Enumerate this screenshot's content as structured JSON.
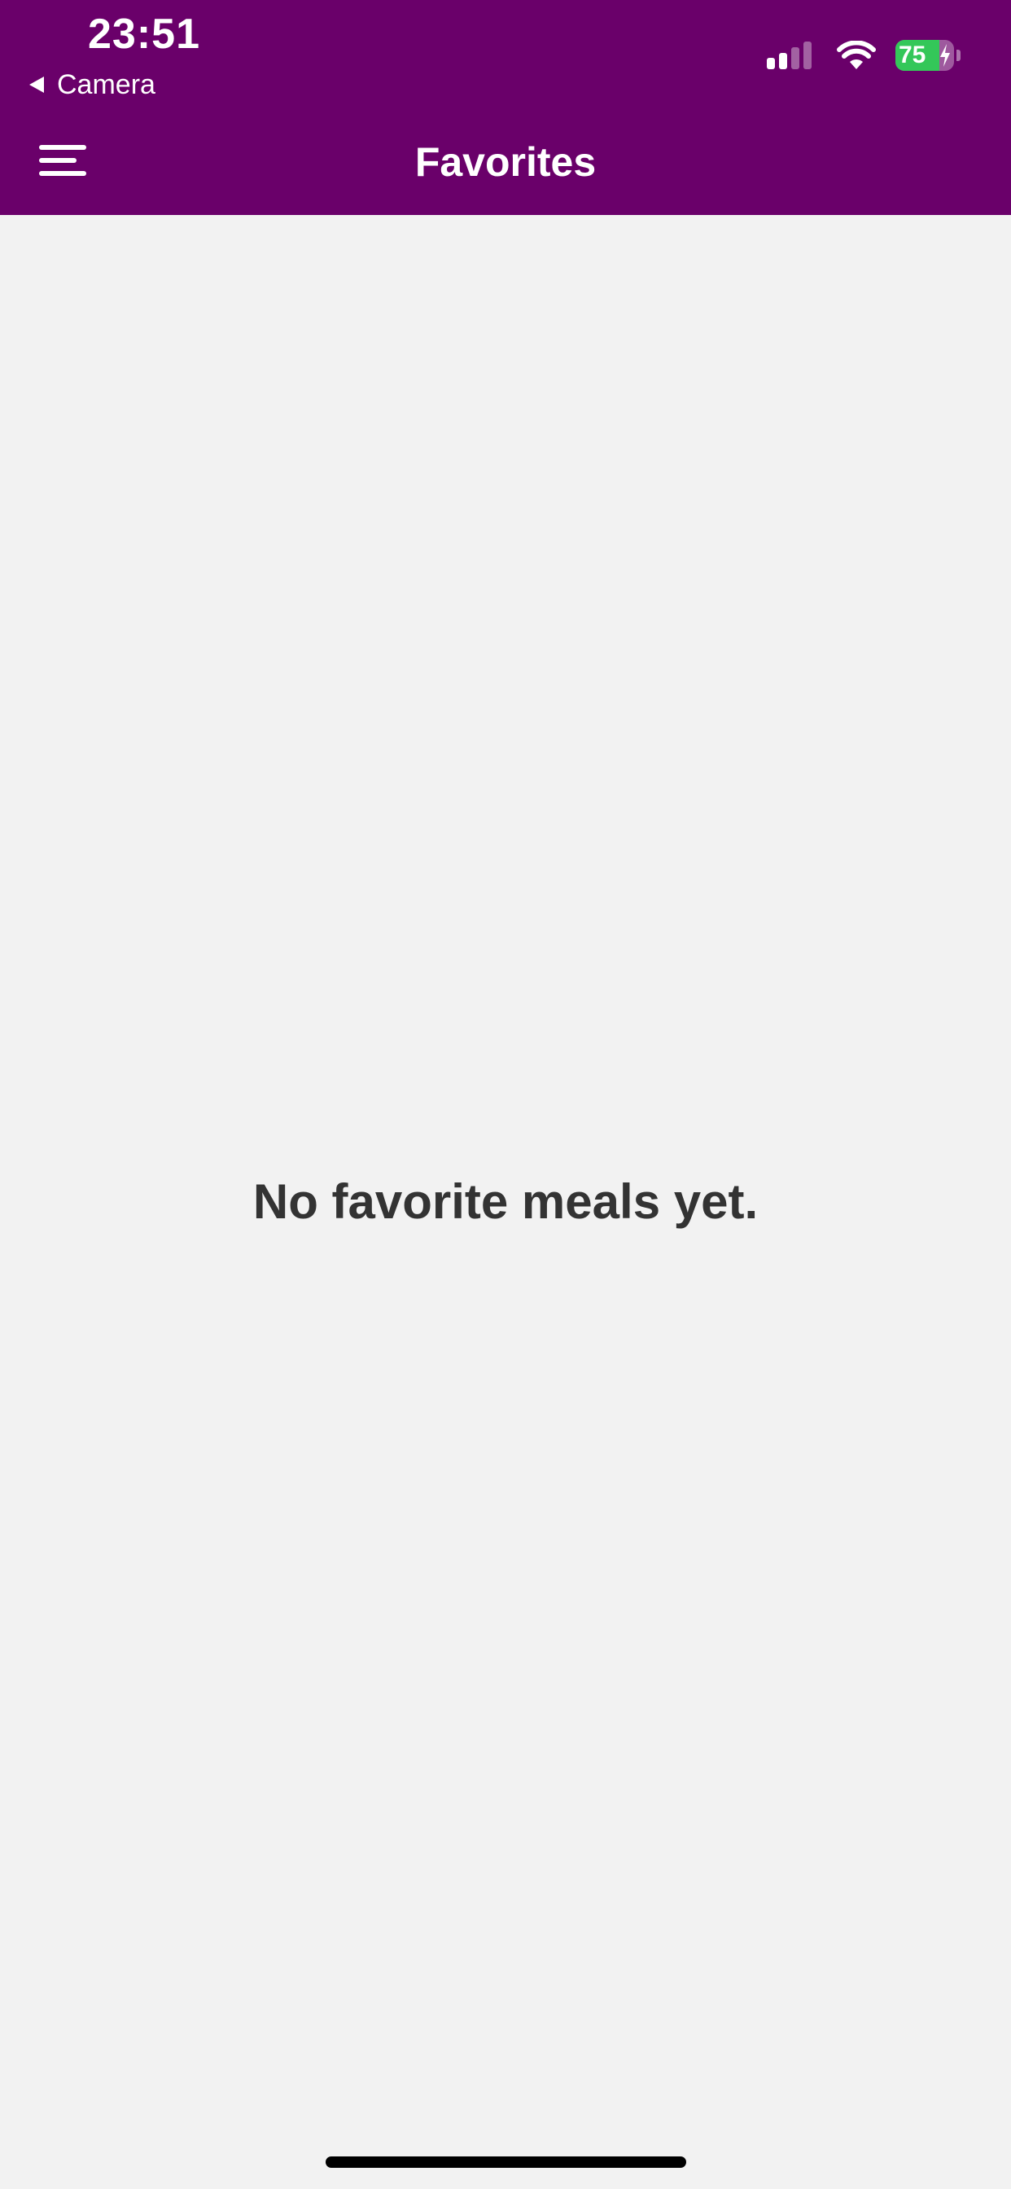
{
  "status_bar": {
    "time": "23:51",
    "back_label": "Camera",
    "battery_percent": "75",
    "battery_level": 0.75,
    "signal_bars_active": 2,
    "signal_bars_total": 4,
    "charging": true
  },
  "header": {
    "title": "Favorites",
    "menu_icon": "hamburger-menu-icon",
    "background_color": "#6a006a"
  },
  "main": {
    "empty_message": "No favorite meals yet."
  },
  "colors": {
    "header": "#6a006a",
    "background": "#f2f2f2",
    "battery": "#34c759",
    "text": "#333333"
  }
}
